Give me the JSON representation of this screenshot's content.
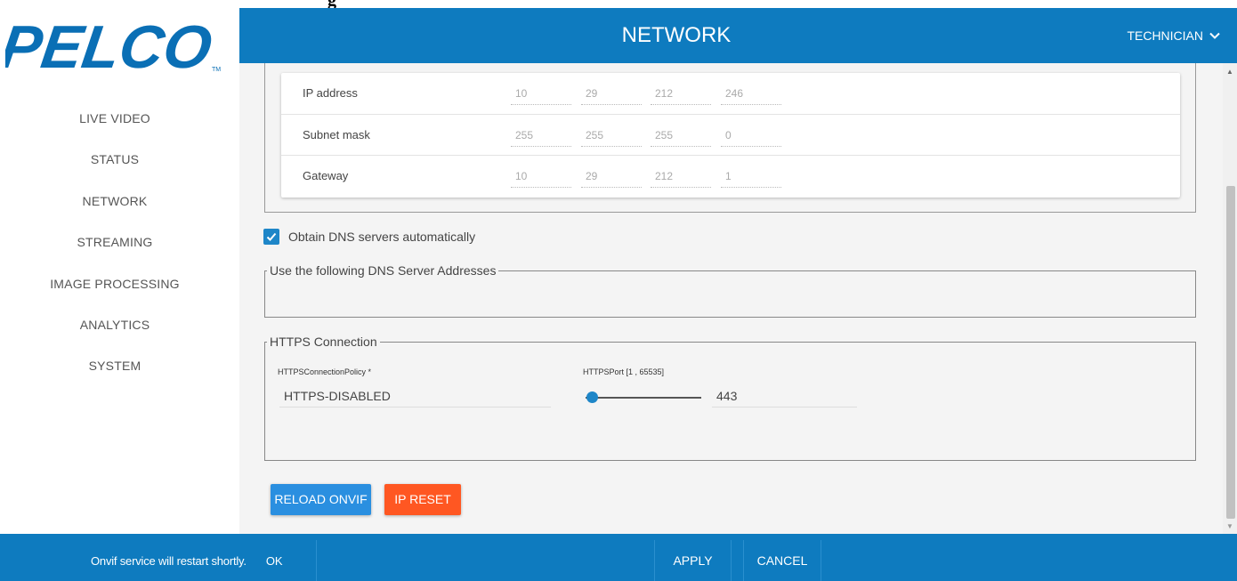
{
  "top_fragment": "g",
  "header": {
    "title": "NETWORK",
    "user_label": "TECHNICIAN"
  },
  "sidebar": {
    "items": [
      {
        "label": "LIVE VIDEO"
      },
      {
        "label": "STATUS"
      },
      {
        "label": "NETWORK"
      },
      {
        "label": "STREAMING"
      },
      {
        "label": "IMAGE PROCESSING"
      },
      {
        "label": "ANALYTICS"
      },
      {
        "label": "SYSTEM"
      }
    ]
  },
  "ipv4": {
    "rows": [
      {
        "label": "IP address",
        "octets": [
          "10",
          "29",
          "212",
          "246"
        ]
      },
      {
        "label": "Subnet mask",
        "octets": [
          "255",
          "255",
          "255",
          "0"
        ]
      },
      {
        "label": "Gateway",
        "octets": [
          "10",
          "29",
          "212",
          "1"
        ]
      }
    ]
  },
  "dns": {
    "auto_label": "Obtain DNS servers automatically",
    "auto_checked": true,
    "manual_legend": "Use the following DNS Server Addresses"
  },
  "https": {
    "legend": "HTTPS Connection",
    "policy_label": "HTTPSConnectionPolicy *",
    "policy_value": "HTTPS-DISABLED",
    "port_label": "HTTPSPort [1 , 65535]",
    "port_value": "443",
    "port_slider_fraction": 0.007
  },
  "actions": {
    "reload_label": "RELOAD ONVIF",
    "ip_reset_label": "IP RESET"
  },
  "snackbar": {
    "message": "Onvif service will restart shortly.",
    "ok_label": "OK"
  },
  "footer": {
    "apply_label": "APPLY",
    "cancel_label": "CANCEL"
  },
  "colors": {
    "primary": "#0e7bbf",
    "checkbox": "#1e86c8",
    "reload_button": "#2a8fe0",
    "reset_button": "#ff5722"
  }
}
